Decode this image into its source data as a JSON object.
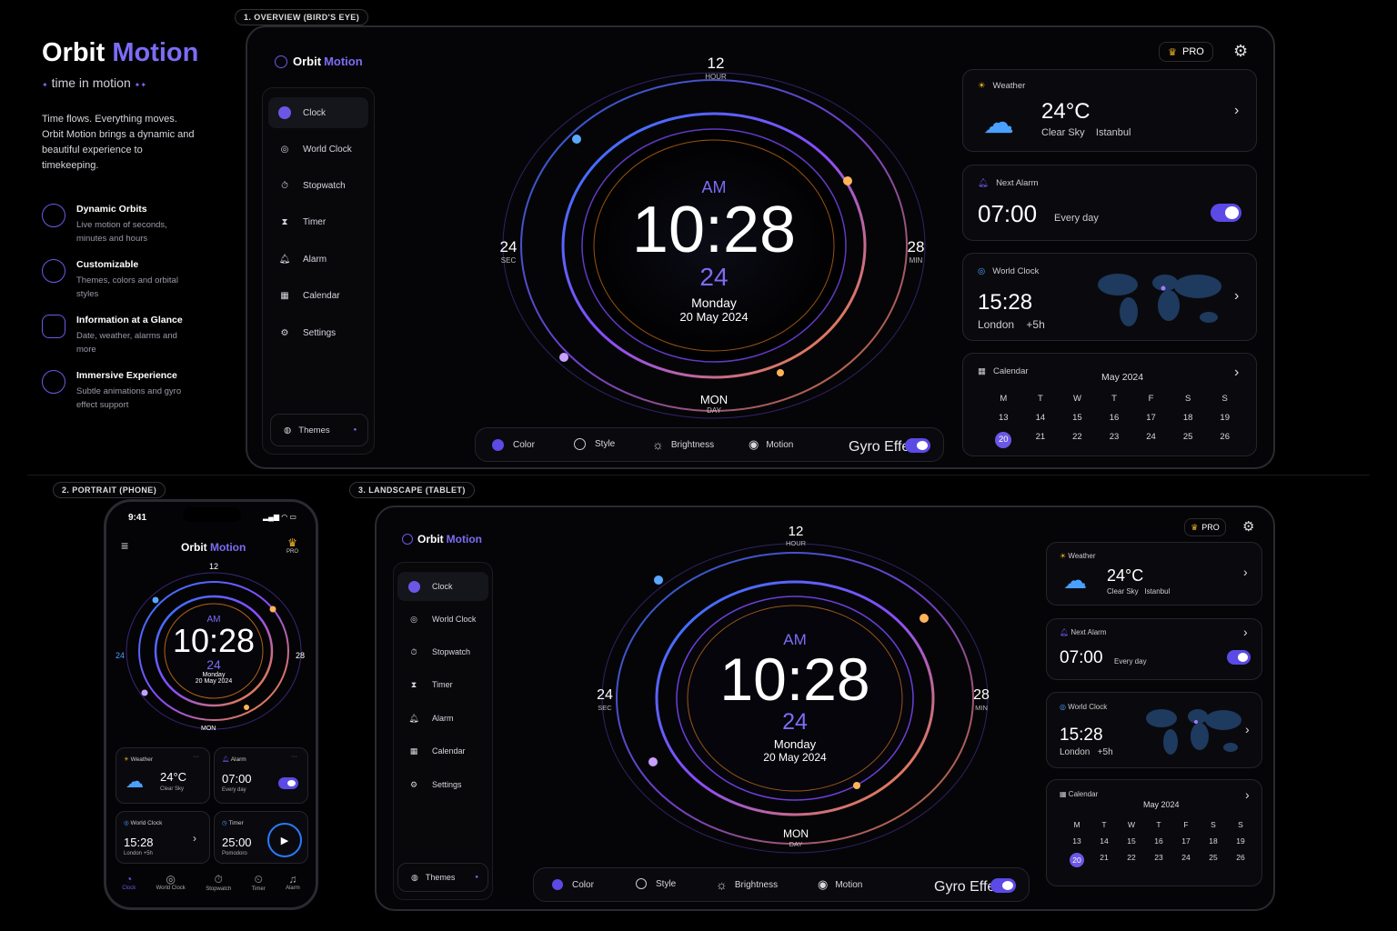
{
  "brand": {
    "part1": "Orbit",
    "part2": "Motion",
    "tagline": "time in motion"
  },
  "intro": "Time flows. Everything moves. Orbit Motion brings a dynamic and beautiful experience to timekeeping.",
  "features": [
    {
      "title": "Dynamic Orbits",
      "desc": "Live motion of seconds, minutes and hours"
    },
    {
      "title": "Customizable",
      "desc": "Themes, colors and orbital styles"
    },
    {
      "title": "Information at a Glance",
      "desc": "Date, weather, alarms and more"
    },
    {
      "title": "Immersive Experience",
      "desc": "Subtle animations and gyro effect support"
    }
  ],
  "sections": {
    "overview": "1. OVERVIEW (BIRD'S EYE)",
    "portrait": "2. PORTRAIT (PHONE)",
    "landscape": "3. LANDSCAPE (TABLET)"
  },
  "nav": [
    "Clock",
    "World Clock",
    "Stopwatch",
    "Timer",
    "Alarm",
    "Calendar",
    "Settings"
  ],
  "themes": "Themes",
  "pro": "PRO",
  "clock": {
    "top": "12",
    "top_label": "HOUR",
    "left": "24",
    "left_label": "SEC",
    "right": "28",
    "right_label": "MIN",
    "bottom": "MON",
    "bottom_label": "DAY",
    "ampm": "AM",
    "time": "10:28",
    "seconds": "24",
    "weekday": "Monday",
    "date": "20 May 2024"
  },
  "controls": {
    "color": "Color",
    "style": "Style",
    "brightness": "Brightness",
    "motion": "Motion",
    "gyro": "Gyro Effect"
  },
  "weather": {
    "title": "Weather",
    "temp": "24°C",
    "cond": "Clear Sky",
    "city": "Istanbul"
  },
  "alarm": {
    "title": "Next Alarm",
    "time": "07:00",
    "repeat": "Every day",
    "title_short": "Alarm"
  },
  "world": {
    "title": "World Clock",
    "time": "15:28",
    "city": "London",
    "offset": "+5h"
  },
  "calendar": {
    "title": "Calendar",
    "month": "May 2024",
    "days": [
      "M",
      "T",
      "W",
      "T",
      "F",
      "S",
      "S"
    ],
    "row1": [
      "13",
      "14",
      "15",
      "16",
      "17",
      "18",
      "19"
    ],
    "row2": [
      "20",
      "21",
      "22",
      "23",
      "24",
      "25",
      "26"
    ]
  },
  "phone": {
    "status_time": "9:41",
    "timer_title": "Timer",
    "timer_value": "25:00",
    "timer_mode": "Pomodoro",
    "tabs": [
      "Clock",
      "World Clock",
      "Stopwatch",
      "Timer",
      "Alarm"
    ],
    "more": "···"
  },
  "colors": {
    "accent": "#6b57e6",
    "blue": "#2a7bff",
    "orange": "#ff8a1f",
    "bg": "#050507"
  }
}
